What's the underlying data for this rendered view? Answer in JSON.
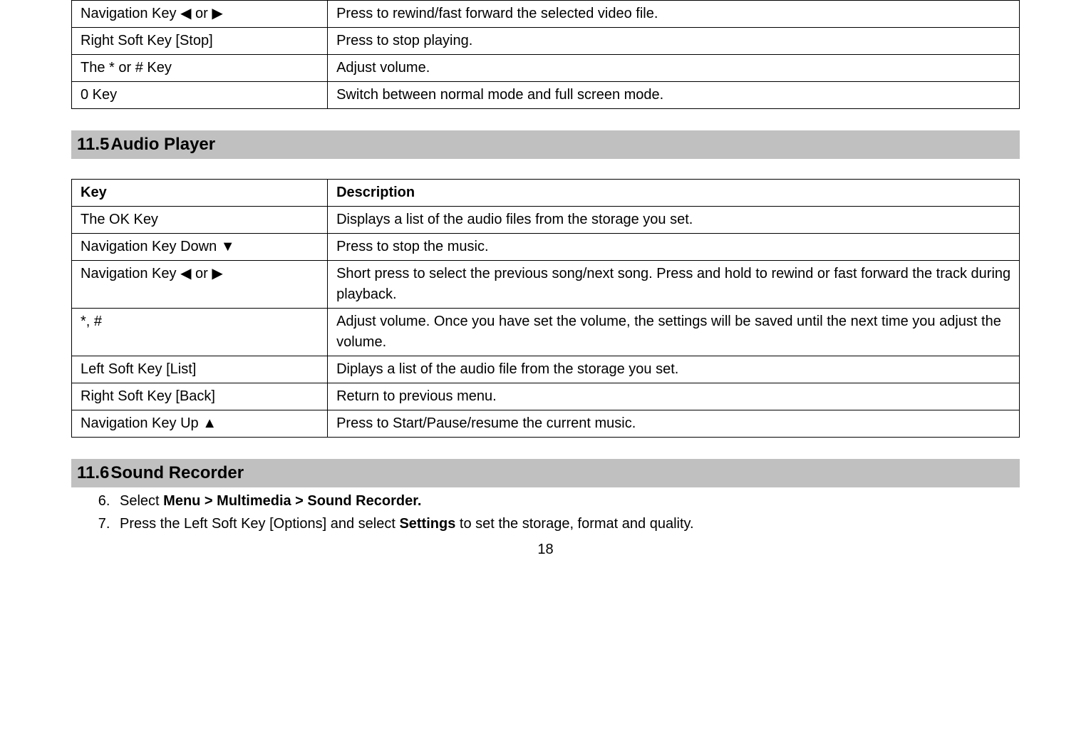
{
  "table1": {
    "rows": [
      {
        "key": "Navigation Key  ◀  or  ▶",
        "desc": "Press to rewind/fast forward the selected video file."
      },
      {
        "key": "Right Soft Key [Stop]",
        "desc": "Press to stop playing."
      },
      {
        "key": "The * or # Key",
        "desc": "Adjust volume."
      },
      {
        "key": "0 Key",
        "desc": "Switch between normal mode and full screen mode."
      }
    ]
  },
  "section_audio": {
    "number": "11.5",
    "title": "Audio Player"
  },
  "table2": {
    "header": {
      "key": "Key",
      "desc": "Description"
    },
    "rows": [
      {
        "key": "The OK Key",
        "desc": "Displays a list of the audio files from the storage you set."
      },
      {
        "key": "Navigation Key Down ▼",
        "desc": "Press to stop the music."
      },
      {
        "key": "Navigation Key  ◀  or  ▶",
        "desc": "Short press to select the previous song/next song. Press and hold to rewind or fast forward the track during playback."
      },
      {
        "key": "*, #",
        "desc": "Adjust volume. Once you have set the volume, the settings will be saved until the next time you adjust the volume."
      },
      {
        "key": "Left Soft Key [List]",
        "desc": "Diplays a list of the audio file from the storage you set."
      },
      {
        "key": "Right Soft Key [Back]",
        "desc": "Return to previous menu."
      },
      {
        "key": "Navigation Key Up ▲",
        "desc": "Press to Start/Pause/resume the current music."
      }
    ]
  },
  "section_recorder": {
    "number": "11.6",
    "title": "Sound Recorder"
  },
  "steps": {
    "start": 6,
    "item6_prefix": "Select ",
    "item6_bold": "Menu > Multimedia > Sound Recorder.",
    "item7_part1": "Press the Left Soft Key [Options] and select ",
    "item7_bold": "Settings",
    "item7_part2": " to set the storage, format and quality."
  },
  "page_number": "18"
}
